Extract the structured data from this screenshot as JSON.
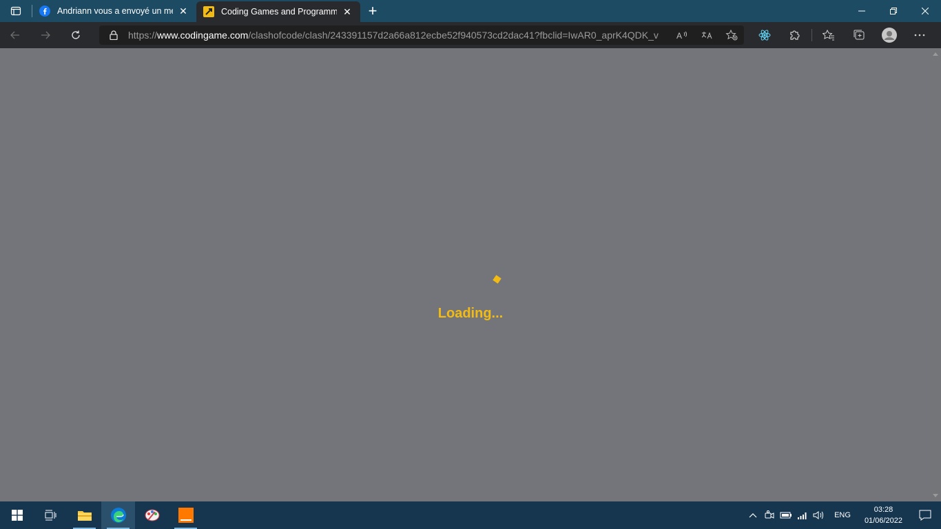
{
  "browser": {
    "tabs": [
      {
        "title": "Andriann vous a envoyé un mess",
        "favicon": "facebook-icon",
        "active": false
      },
      {
        "title": "Coding Games and Programming",
        "favicon": "codingame-icon",
        "active": true
      }
    ],
    "address": {
      "scheme": "https://",
      "host": "www.codingame.com",
      "path": "/clashofcode/clash/243391157d2a66a812ecbe52f940573cd2dac41?fbclid=IwAR0_aprK4QDK_v..."
    }
  },
  "page": {
    "loading_text": "Loading...",
    "accent": "#f2bb13",
    "background": "#74757a"
  },
  "taskbar": {
    "apps": [
      "start-icon",
      "task-view-icon",
      "file-explorer-icon",
      "edge-icon",
      "paint-icon",
      "orange-app-icon"
    ],
    "language": "ENG",
    "time": "03:28",
    "date": "01/06/2022"
  }
}
